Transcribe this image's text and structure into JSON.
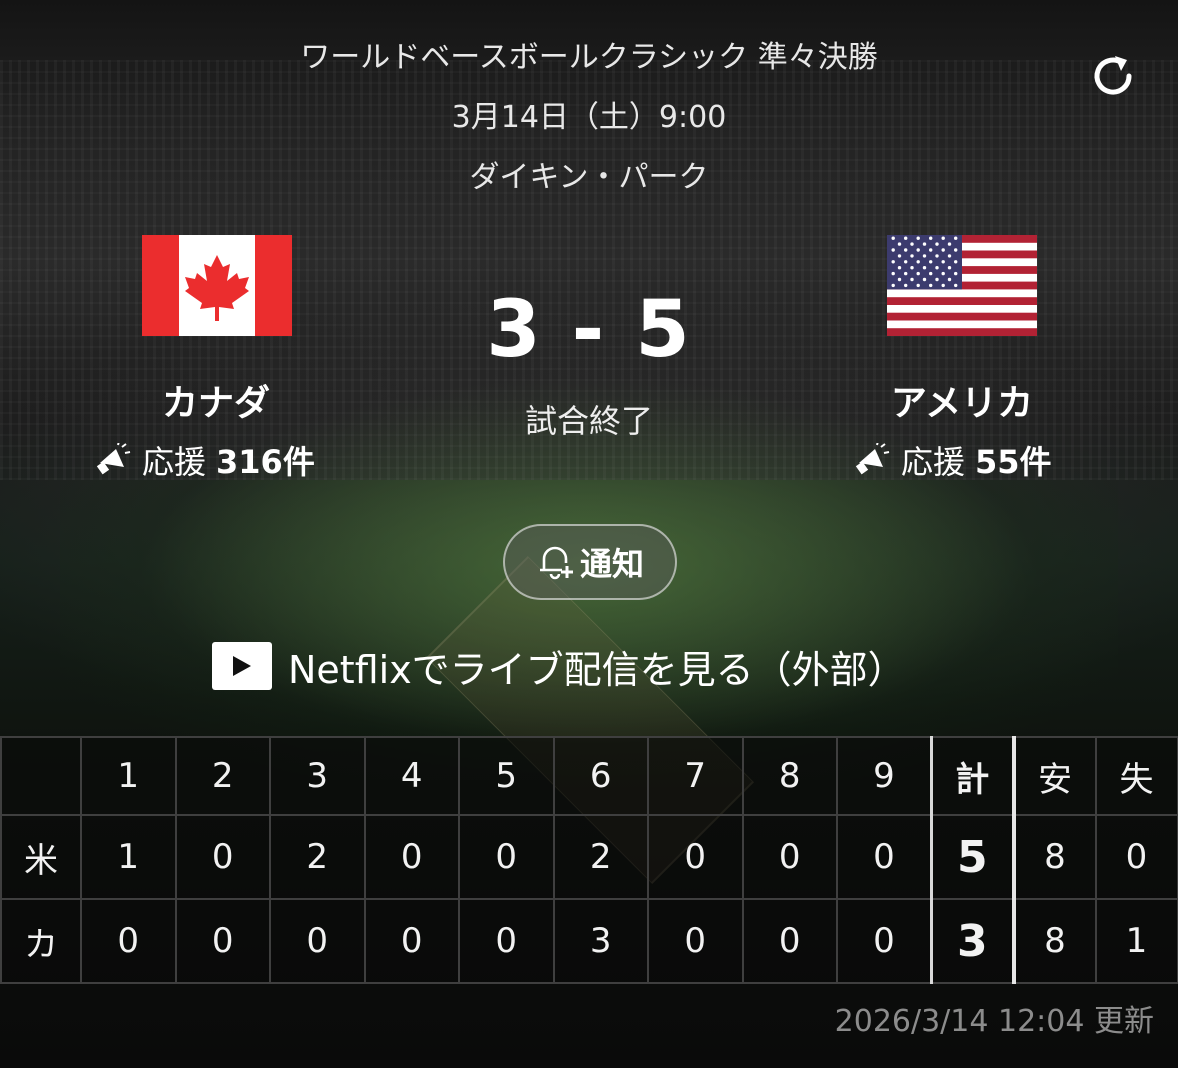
{
  "match": {
    "tournament": "ワールドベースボールクラシック  準々決勝",
    "datetime": "3月14日（土）9:00",
    "venue": "ダイキン・パーク",
    "score": "3 - 5",
    "status": "試合終了"
  },
  "home": {
    "name": "カナダ",
    "cheer_label": "応援",
    "cheer_count": "316件",
    "flag": "canada-flag"
  },
  "away": {
    "name": "アメリカ",
    "cheer_label": "応援",
    "cheer_count": "55件",
    "flag": "usa-flag"
  },
  "actions": {
    "notify_label": "通知",
    "watch_label": "Netflixでライブ配信を見る（外部）"
  },
  "scoreboard": {
    "headers": [
      "",
      "1",
      "2",
      "3",
      "4",
      "5",
      "6",
      "7",
      "8",
      "9",
      "計",
      "安",
      "失"
    ],
    "rows": [
      [
        "米",
        "1",
        "0",
        "2",
        "0",
        "0",
        "2",
        "0",
        "0",
        "0",
        "5",
        "8",
        "0"
      ],
      [
        "カ",
        "0",
        "0",
        "0",
        "0",
        "0",
        "3",
        "0",
        "0",
        "0",
        "3",
        "8",
        "1"
      ]
    ]
  },
  "updated": "2026/3/14 12:04 更新",
  "colors": {
    "canada_red": "#eb2d2e",
    "usa_red": "#b22234",
    "usa_blue": "#3c3b6e",
    "text": "#ffffff",
    "muted": "#8c8c8c"
  }
}
